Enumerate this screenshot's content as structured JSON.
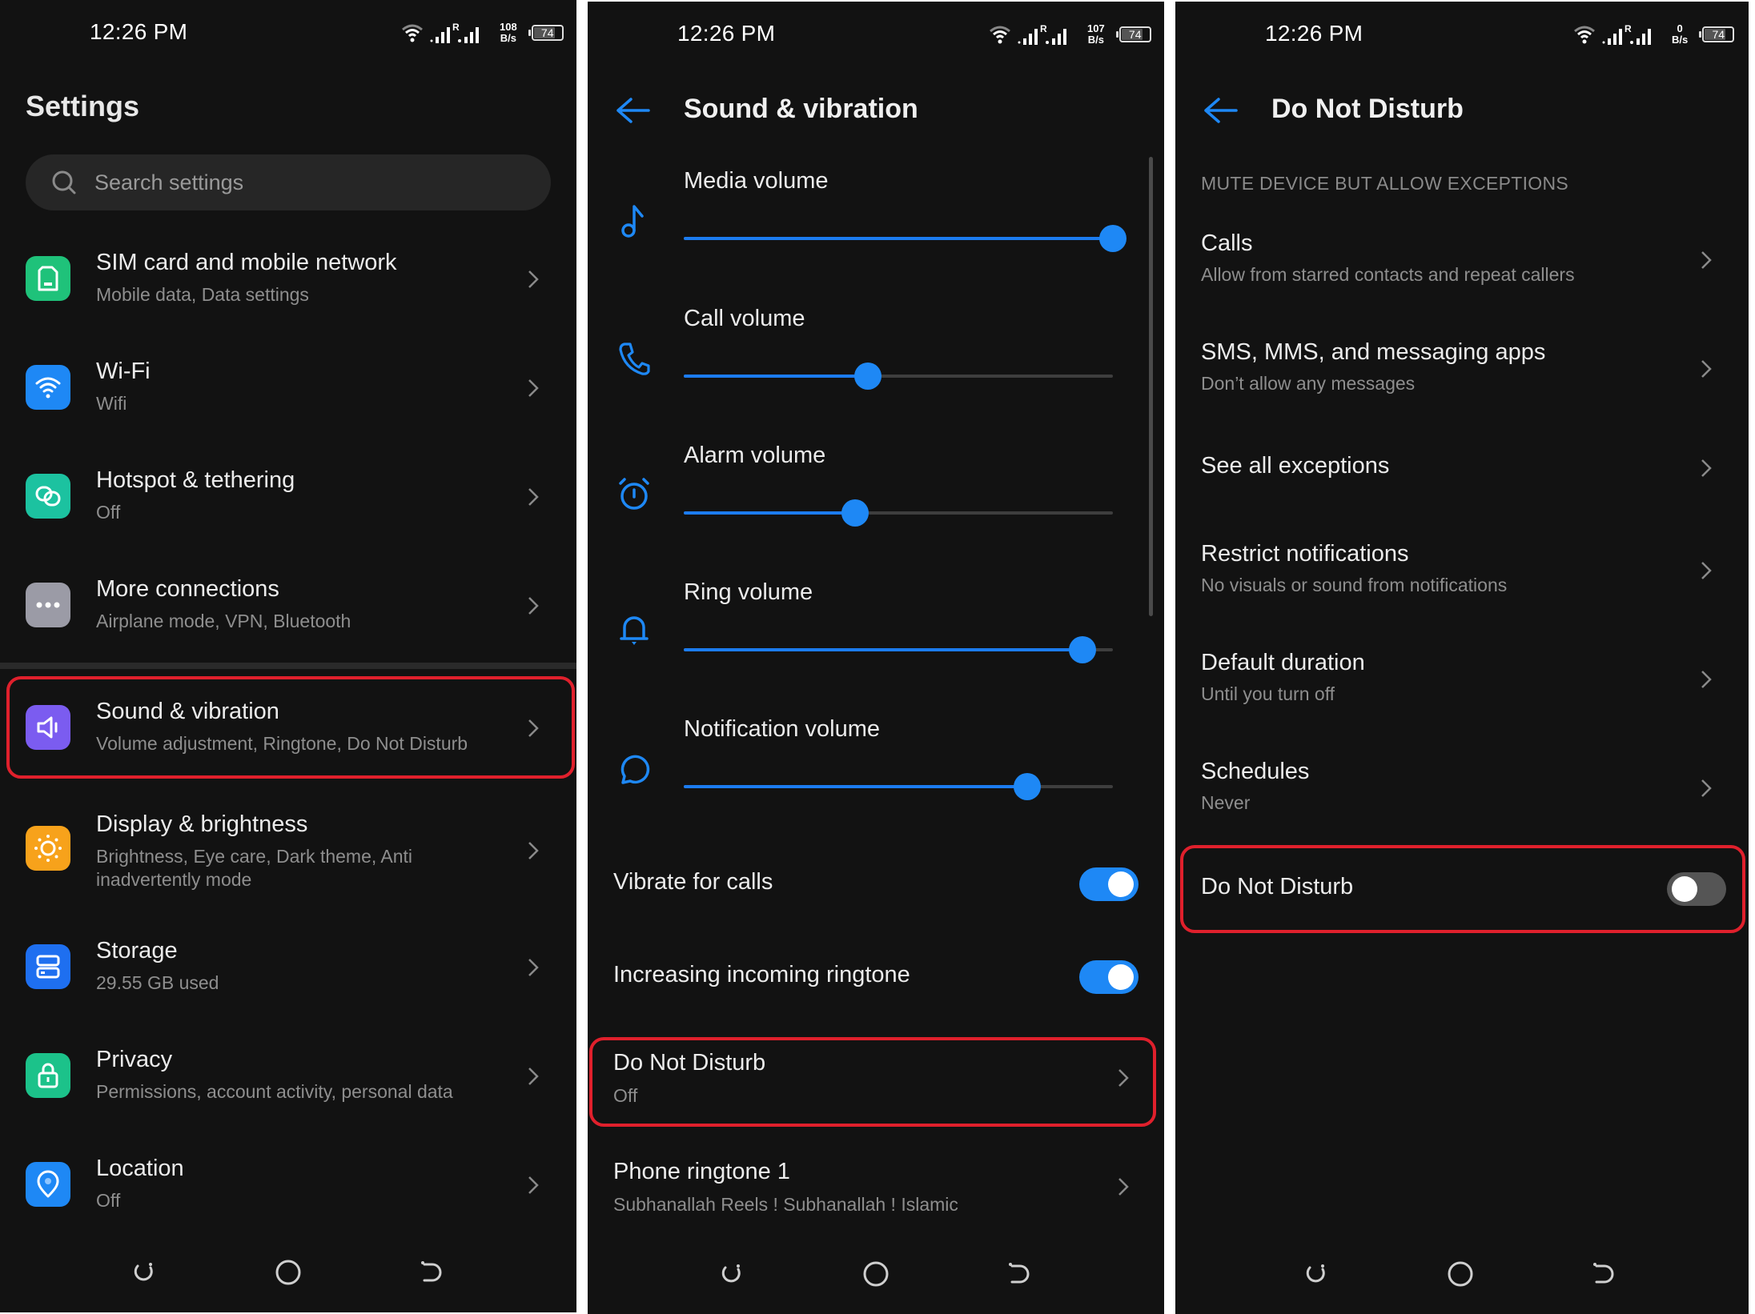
{
  "colors": {
    "accent": "#1e88f5",
    "highlight": "#e0202c",
    "background": "#121212"
  },
  "settings_panel": {
    "status_bar": {
      "time": "12:26 PM",
      "speed_value": "108",
      "speed_unit": "B/s",
      "battery": "74",
      "roaming": "R"
    },
    "title": "Settings",
    "search": {
      "placeholder": "Search settings",
      "value": ""
    },
    "items": [
      {
        "title": "SIM card and mobile network",
        "subtitle": "Mobile data, Data settings",
        "icon": "sim-card-icon",
        "color": "#1fc27a"
      },
      {
        "title": "Wi-Fi",
        "subtitle": "Wifi",
        "icon": "wifi-icon",
        "color": "#1e88f5"
      },
      {
        "title": "Hotspot & tethering",
        "subtitle": "Off",
        "icon": "hotspot-icon",
        "color": "#1cc2a0"
      },
      {
        "title": "More connections",
        "subtitle": "Airplane mode, VPN, Bluetooth",
        "icon": "more-dots-icon",
        "color": "#9b9ba6"
      },
      {
        "title": "Sound & vibration",
        "subtitle": "Volume adjustment, Ringtone, Do Not Disturb",
        "icon": "speaker-icon",
        "color": "#7b5cf0",
        "highlighted": true
      },
      {
        "title": "Display & brightness",
        "subtitle": "Brightness, Eye care, Dark theme, Anti inadvertently mode",
        "icon": "sun-icon",
        "color": "#f7a21b"
      },
      {
        "title": "Storage",
        "subtitle": "29.55 GB used",
        "icon": "storage-icon",
        "color": "#1e6ff0"
      },
      {
        "title": "Privacy",
        "subtitle": "Permissions, account activity, personal data",
        "icon": "lock-icon",
        "color": "#1cc28a"
      },
      {
        "title": "Location",
        "subtitle": "Off",
        "icon": "location-pin-icon",
        "color": "#1e88f5"
      }
    ]
  },
  "sound_panel": {
    "status_bar": {
      "time": "12:26 PM",
      "speed_value": "107",
      "speed_unit": "B/s",
      "battery": "74",
      "roaming": "R"
    },
    "title": "Sound & vibration",
    "sliders": [
      {
        "label": "Media volume",
        "icon": "music-note-icon",
        "value_percent": 100
      },
      {
        "label": "Call volume",
        "icon": "phone-icon",
        "value_percent": 43
      },
      {
        "label": "Alarm volume",
        "icon": "alarm-clock-icon",
        "value_percent": 40
      },
      {
        "label": "Ring volume",
        "icon": "bell-icon",
        "value_percent": 93
      },
      {
        "label": "Notification volume",
        "icon": "chat-bubble-icon",
        "value_percent": 80
      }
    ],
    "toggles": [
      {
        "label": "Vibrate for calls",
        "on": true
      },
      {
        "label": "Increasing incoming ringtone",
        "on": true
      }
    ],
    "dnd": {
      "title": "Do Not Disturb",
      "subtitle": "Off",
      "highlighted": true
    },
    "ringtone": {
      "title": "Phone ringtone 1",
      "subtitle": "Subhanallah Reels ! Subhanallah ! Islamic"
    }
  },
  "dnd_panel": {
    "status_bar": {
      "time": "12:26 PM",
      "speed_value": "0",
      "speed_unit": "B/s",
      "battery": "74",
      "roaming": "R"
    },
    "title": "Do Not Disturb",
    "section_header": "MUTE DEVICE BUT ALLOW EXCEPTIONS",
    "items": [
      {
        "title": "Calls",
        "subtitle": "Allow from starred contacts and repeat callers"
      },
      {
        "title": "SMS, MMS, and messaging apps",
        "subtitle": "Don’t allow any messages"
      },
      {
        "title": "See all exceptions",
        "subtitle": ""
      },
      {
        "title": "Restrict notifications",
        "subtitle": "No visuals or sound from notifications"
      },
      {
        "title": "Default duration",
        "subtitle": "Until you turn off"
      },
      {
        "title": "Schedules",
        "subtitle": "Never"
      }
    ],
    "toggle": {
      "label": "Do Not Disturb",
      "on": false,
      "highlighted": true
    }
  }
}
